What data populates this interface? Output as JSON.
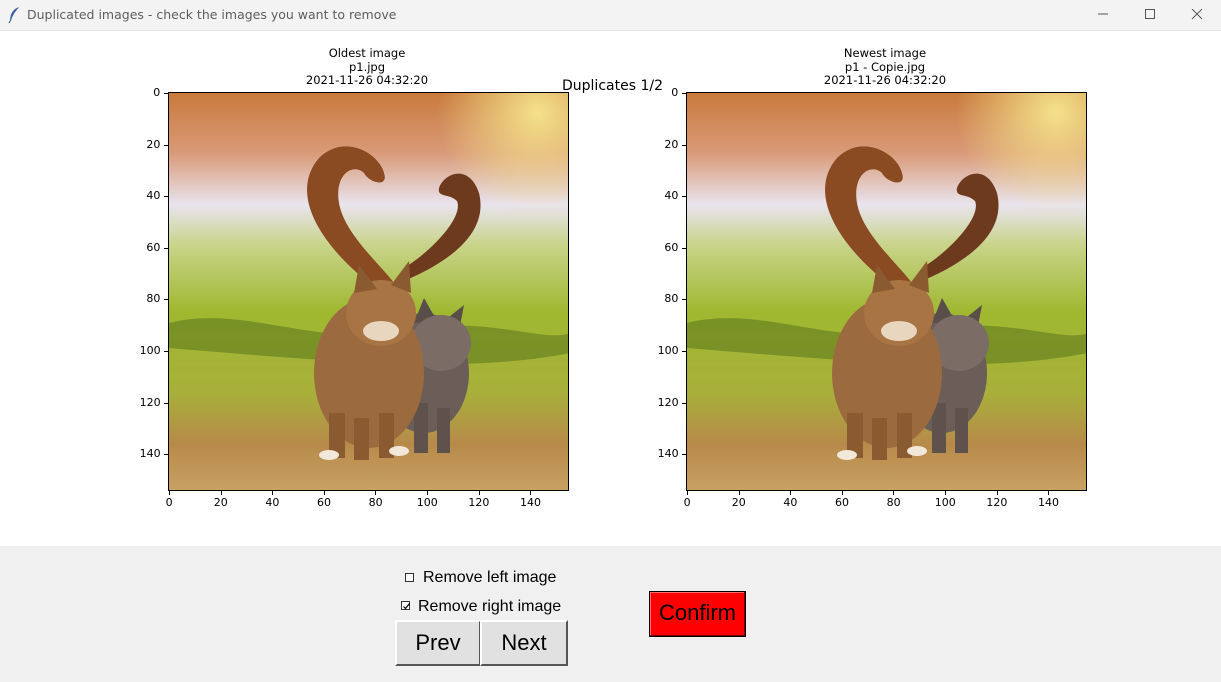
{
  "window": {
    "title": "Duplicated images - check the images you want to remove"
  },
  "figure": {
    "suptitle": "Duplicates 1/2",
    "left": {
      "title_line1": "Oldest image",
      "title_line2": "p1.jpg",
      "title_line3": "2021-11-26 04:32:20",
      "image_desc_icon": "two-cats-photo"
    },
    "right": {
      "title_line1": "Newest image",
      "title_line2": "p1 - Copie.jpg",
      "title_line3": "2021-11-26 04:32:20",
      "image_desc_icon": "two-cats-photo"
    },
    "x_ticks": [
      "0",
      "20",
      "40",
      "60",
      "80",
      "100",
      "120",
      "140"
    ],
    "y_ticks": [
      "0",
      "20",
      "40",
      "60",
      "80",
      "100",
      "120",
      "140"
    ],
    "axis_range": {
      "x": [
        0,
        155
      ],
      "y": [
        0,
        155
      ]
    }
  },
  "controls": {
    "remove_left_label": "Remove left image",
    "remove_left_checked": false,
    "remove_right_label": "Remove right image",
    "remove_right_checked": true,
    "prev_label": "Prev",
    "next_label": "Next",
    "confirm_label": "Confirm",
    "confirm_color": "#ff0000"
  }
}
